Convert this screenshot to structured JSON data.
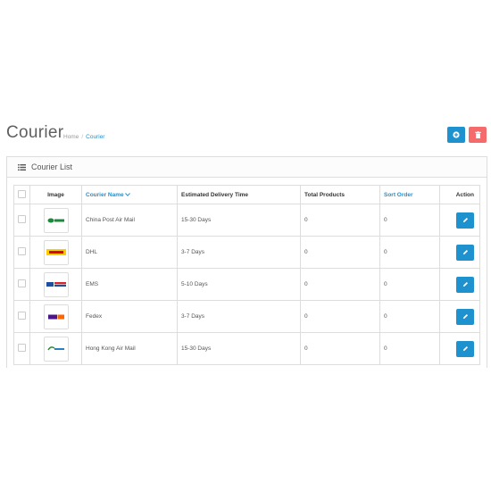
{
  "header": {
    "title": "Courier",
    "breadcrumb": [
      "Home",
      "Courier"
    ]
  },
  "colors": {
    "primary": "#1e91cf",
    "danger": "#f56b6b",
    "dhl_yellow": "#ffcc00",
    "dhl_red": "#d40511"
  },
  "panel": {
    "title": "Courier List"
  },
  "table": {
    "headers": {
      "image": "Image",
      "name": "Courier Name",
      "time": "Estimated Delivery Time",
      "total": "Total Products",
      "sort": "Sort Order",
      "action": "Action"
    },
    "rows": [
      {
        "logo": "china-post-logo",
        "name": "China Post Air Mail",
        "time": "15-30 Days",
        "total": "0",
        "sort": "0"
      },
      {
        "logo": "dhl-logo",
        "name": "DHL",
        "time": "3-7 Days",
        "total": "0",
        "sort": "0"
      },
      {
        "logo": "ems-logo",
        "name": "EMS",
        "time": "5-10 Days",
        "total": "0",
        "sort": "0"
      },
      {
        "logo": "fedex-logo",
        "name": "Fedex",
        "time": "3-7 Days",
        "total": "0",
        "sort": "0"
      },
      {
        "logo": "hongkong-post-logo",
        "name": "Hong Kong Air Mail",
        "time": "15-30 Days",
        "total": "0",
        "sort": "0"
      }
    ]
  }
}
